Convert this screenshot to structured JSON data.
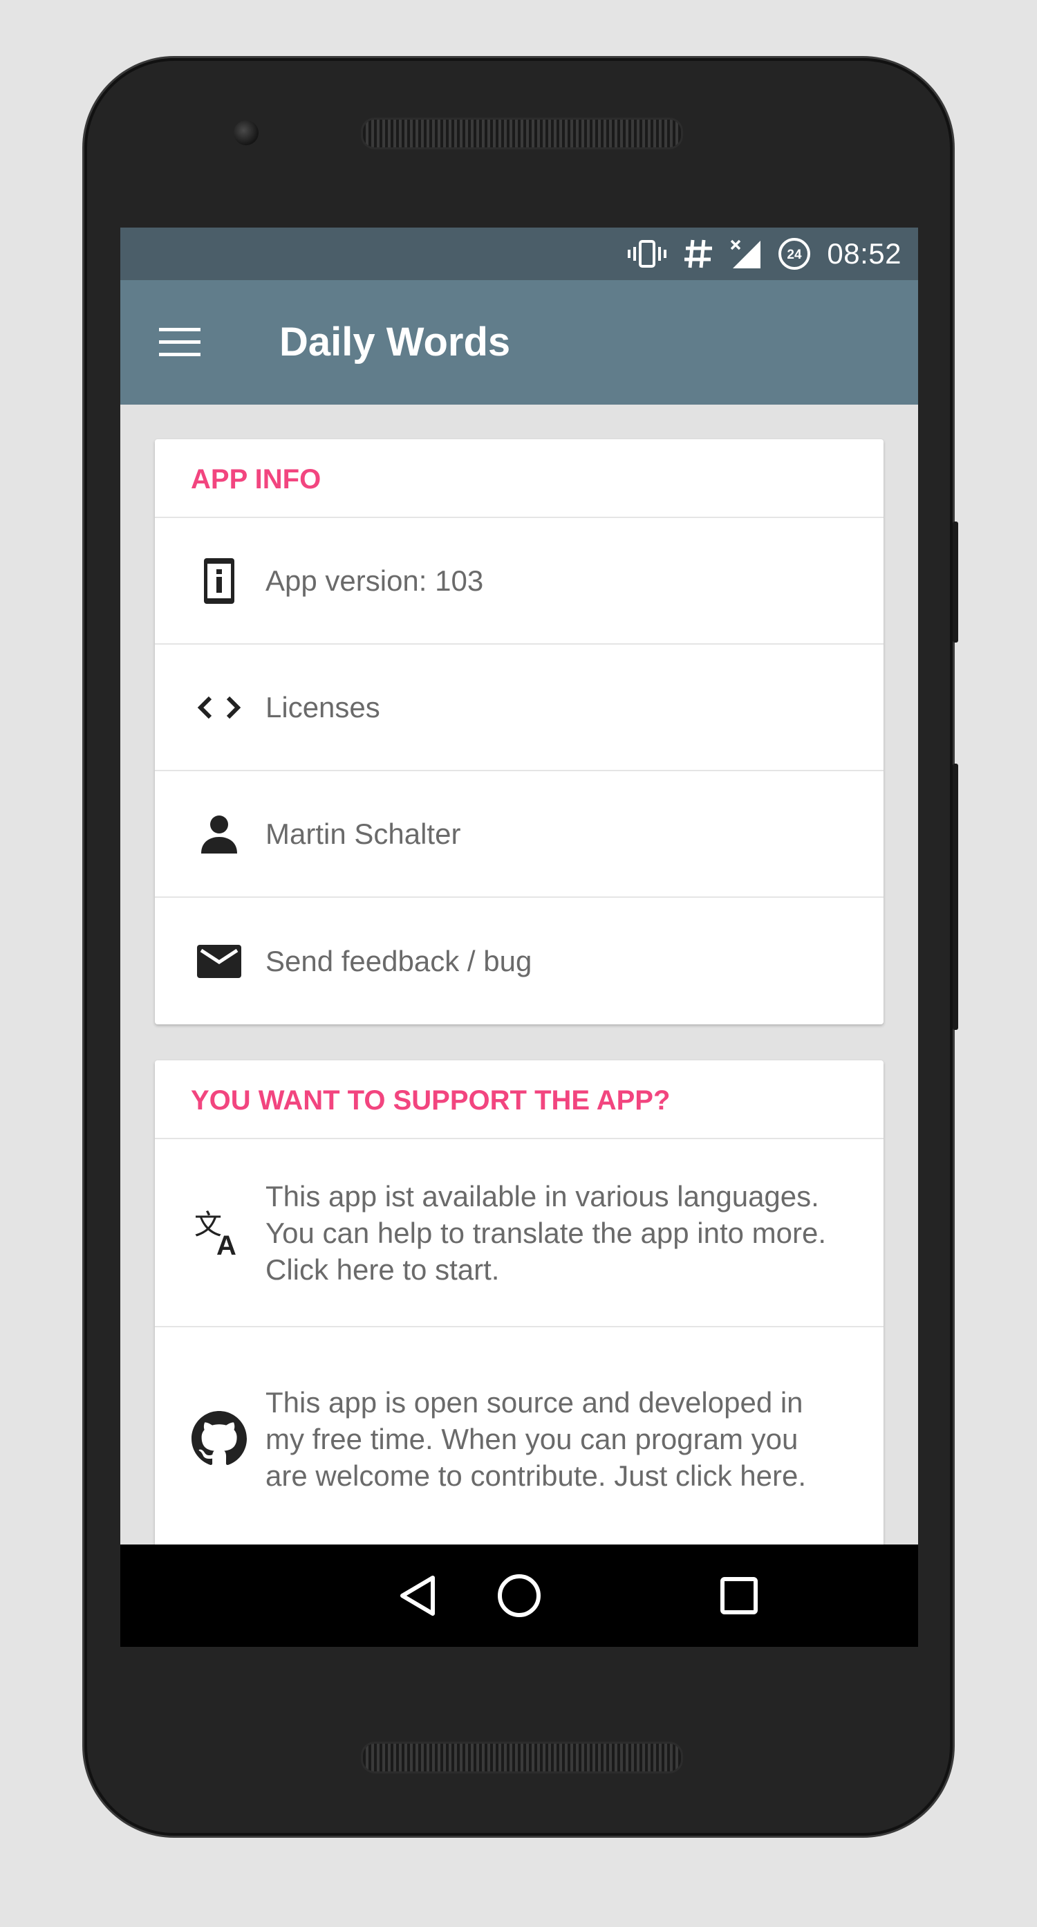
{
  "status_bar": {
    "time": "08:52",
    "icons": [
      "vibrate-icon",
      "hashtag-icon",
      "no-signal-icon",
      "data-saver-24-icon"
    ]
  },
  "app_bar": {
    "title": "Daily Words",
    "menu_icon": "hamburger-menu-icon"
  },
  "app_info": {
    "header": "APP INFO",
    "items": [
      {
        "icon": "app-info-icon",
        "label": "App version: 103"
      },
      {
        "icon": "code-icon",
        "label": "Licenses"
      },
      {
        "icon": "person-icon",
        "label": "Martin Schalter"
      },
      {
        "icon": "mail-icon",
        "label": "Send feedback / bug"
      }
    ]
  },
  "support": {
    "header": "YOU WANT TO SUPPORT THE APP?",
    "items": [
      {
        "icon": "translate-icon",
        "label": "This app ist available in various languages. You can help to translate the app into more. Click here to start."
      },
      {
        "icon": "github-icon",
        "label": "This app is open source and developed in my free time. When you can program you are welcome to contribute. Just click here."
      }
    ]
  },
  "navigation_bar": {
    "icons": [
      "back-icon",
      "home-icon",
      "recents-icon"
    ]
  },
  "colors": {
    "status_bar": "#4b5e69",
    "app_bar": "#617d8b",
    "accent": "#f2457f",
    "background": "#e2e2e2",
    "item_text": "#6a6a6a"
  }
}
